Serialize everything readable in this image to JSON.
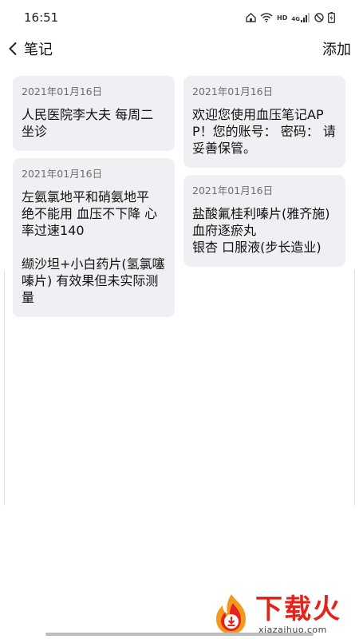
{
  "status": {
    "time": "16:51",
    "hd_label": "HD",
    "signal_label": "4G"
  },
  "nav": {
    "title": "笔记",
    "add_label": "添加"
  },
  "notes": {
    "left": [
      {
        "date": "2021年01月16日",
        "text": "人民医院李大夫 每周二坐诊"
      },
      {
        "date": "2021年01月16日",
        "text": "左氨氯地平和硝氨地平 绝不能用 血压不下降 心率过速140\n\n缬沙坦+小白药片(氢氯噻嗪片) 有效果但未实际测量"
      }
    ],
    "right": [
      {
        "date": "2021年01月16日",
        "text": "欢迎您使用血压笔记APP！您的账号： 密码： 请妥善保管。"
      },
      {
        "date": "2021年01月16日",
        "text": "盐酸氟桂利嗪片(雅齐施)\n血府逐瘀丸\n银杏 口服液(步长造业)"
      }
    ]
  },
  "watermark": {
    "title": "下载火",
    "url": "xiazaihuo.com"
  },
  "colors": {
    "card_bg": "#eef0f3",
    "watermark_red": "#e5231a",
    "watermark_orange": "#f39a1e"
  }
}
